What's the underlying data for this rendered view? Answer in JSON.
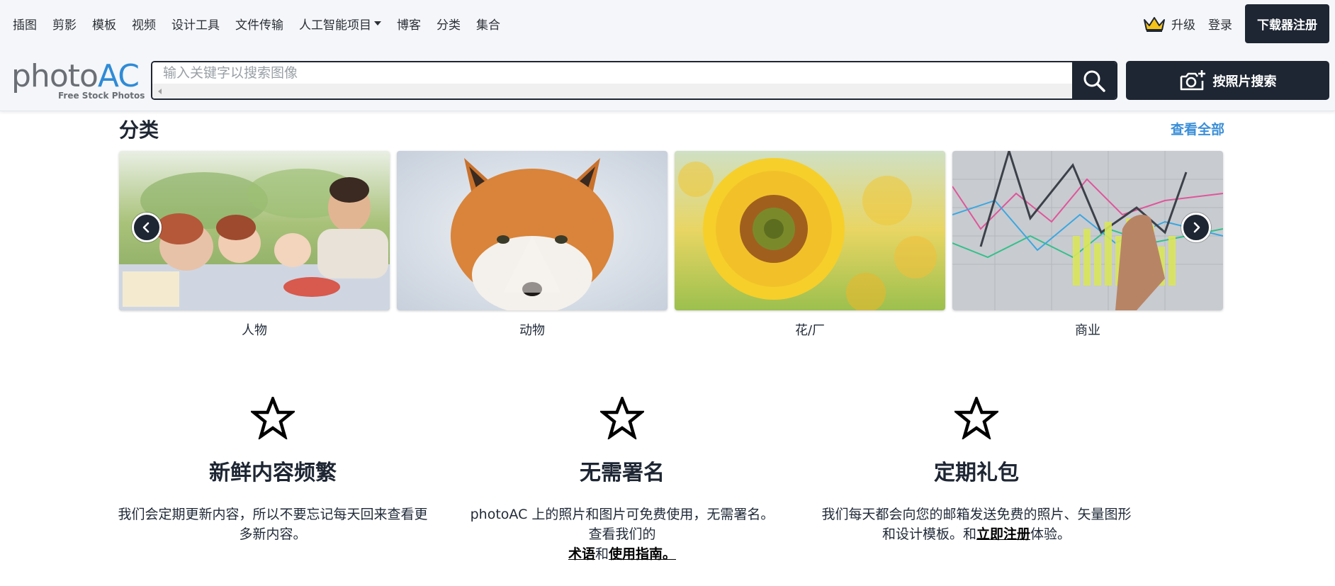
{
  "nav": {
    "items": [
      "插图",
      "剪影",
      "模板",
      "视频",
      "设计工具",
      "文件传输"
    ],
    "ai_projects": "人工智能项目",
    "items_after": [
      "博客",
      "分类",
      "集合"
    ]
  },
  "header_right": {
    "upgrade": "升级",
    "login": "登录",
    "register": "下载器注册"
  },
  "logo": {
    "photo": "photo",
    "ac": "AC",
    "tagline": "Free Stock Photos"
  },
  "search": {
    "placeholder": "输入关键字以搜索图像",
    "photo_search": "按照片搜索"
  },
  "categories": {
    "title": "分类",
    "view_all": "查看全部",
    "items": [
      {
        "label": "人物",
        "image": "family-picnic"
      },
      {
        "label": "动物",
        "image": "red-fox"
      },
      {
        "label": "花/厂",
        "image": "sunflower"
      },
      {
        "label": "商业",
        "image": "business-chart"
      }
    ]
  },
  "features": [
    {
      "icon": "star-icon",
      "title": "新鲜内容频繁",
      "text": "我们会定期更新内容，所以不要忘记每天回来查看更多新内容。"
    },
    {
      "icon": "star-icon",
      "title": "无需署名",
      "text_before": "photoAC 上的照片和图片可免费使用，无需署名。查看我们的",
      "link1": "术语",
      "middle": "和",
      "link2": "使用指南。"
    },
    {
      "icon": "star-icon",
      "title": "定期礼包",
      "text_before": "我们每天都会向您的邮箱发送免费的照片、矢量图形和设计模板。和",
      "link": "立即注册",
      "text_after": "体验。"
    }
  ],
  "colors": {
    "dark": "#1e2633",
    "accent": "#3b8fd8",
    "header_bg": "#f4f6f9"
  }
}
